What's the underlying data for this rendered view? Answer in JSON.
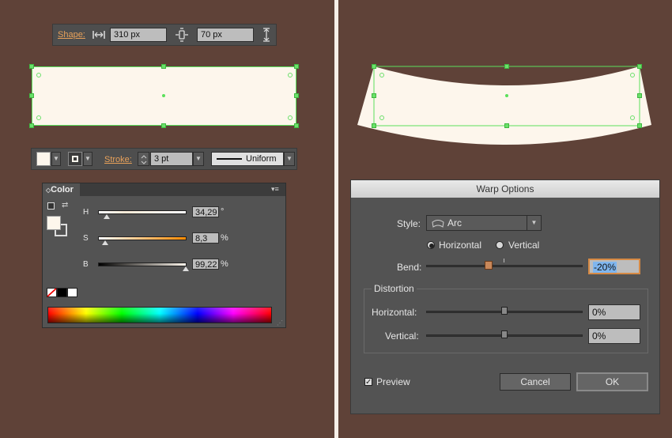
{
  "shape_toolbar": {
    "label": "Shape:",
    "width_value": "310 px",
    "height_value": "70 px"
  },
  "appearance_toolbar": {
    "stroke_label": "Stroke:",
    "stroke_weight": "3 pt",
    "profile": "Uniform"
  },
  "color_panel": {
    "title": "Color",
    "sliders": [
      {
        "label": "H",
        "value": "34,29",
        "unit": "°",
        "level": 0.095
      },
      {
        "label": "S",
        "value": "8,3",
        "unit": "%",
        "level": 0.083
      },
      {
        "label": "B",
        "value": "99,22",
        "unit": "%",
        "level": 0.992
      }
    ]
  },
  "warp_dialog": {
    "title": "Warp Options",
    "style_label": "Style:",
    "style_value": "Arc",
    "horizontal_label": "Horizontal",
    "vertical_label": "Vertical",
    "bend_label": "Bend:",
    "bend_value": "-20%",
    "bend_level": -0.2,
    "distortion_title": "Distortion",
    "dist_horizontal_label": "Horizontal:",
    "dist_horizontal_value": "0%",
    "dist_vertical_label": "Vertical:",
    "dist_vertical_value": "0%",
    "preview_label": "Preview",
    "cancel_label": "Cancel",
    "ok_label": "OK"
  },
  "colors": {
    "background": "#5f4238",
    "fill": "#fdf6ec",
    "selection": "#5be05b",
    "accent_label": "#e8a15a"
  }
}
